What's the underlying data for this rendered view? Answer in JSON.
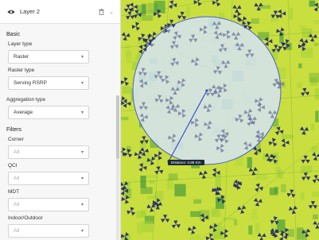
{
  "layer": {
    "title": "Layer 2",
    "eye_icon": "eye-icon",
    "trash_icon": "trash-icon",
    "chevron_icon": "chevron-down-icon"
  },
  "basic": {
    "section_title": "Basic",
    "layer_type": {
      "label": "Layer type",
      "value": "Raster"
    },
    "raster_type": {
      "label": "Raster type",
      "value": "Serving RSRP"
    }
  },
  "aggregation": {
    "label": "Aggregation type",
    "value": "Average"
  },
  "filters": {
    "section_title": "Filters",
    "corner": {
      "label": "Corner",
      "value": "All"
    },
    "qci": {
      "label": "QCI",
      "value": "All"
    },
    "mdt": {
      "label": "MDT",
      "value": "All"
    },
    "indoor_outdoor": {
      "label": "Indoor/Outdoor",
      "value": "All"
    }
  },
  "map": {
    "distance_label": "Distance: 3.86 Km",
    "colors": {
      "base": "#c9df3f",
      "high": "#9fd037",
      "low": "#2f8f3a",
      "circle_fill": "#cfe0f5",
      "circle_stroke": "#4a5fd0",
      "site": "#2a2f6a"
    }
  }
}
